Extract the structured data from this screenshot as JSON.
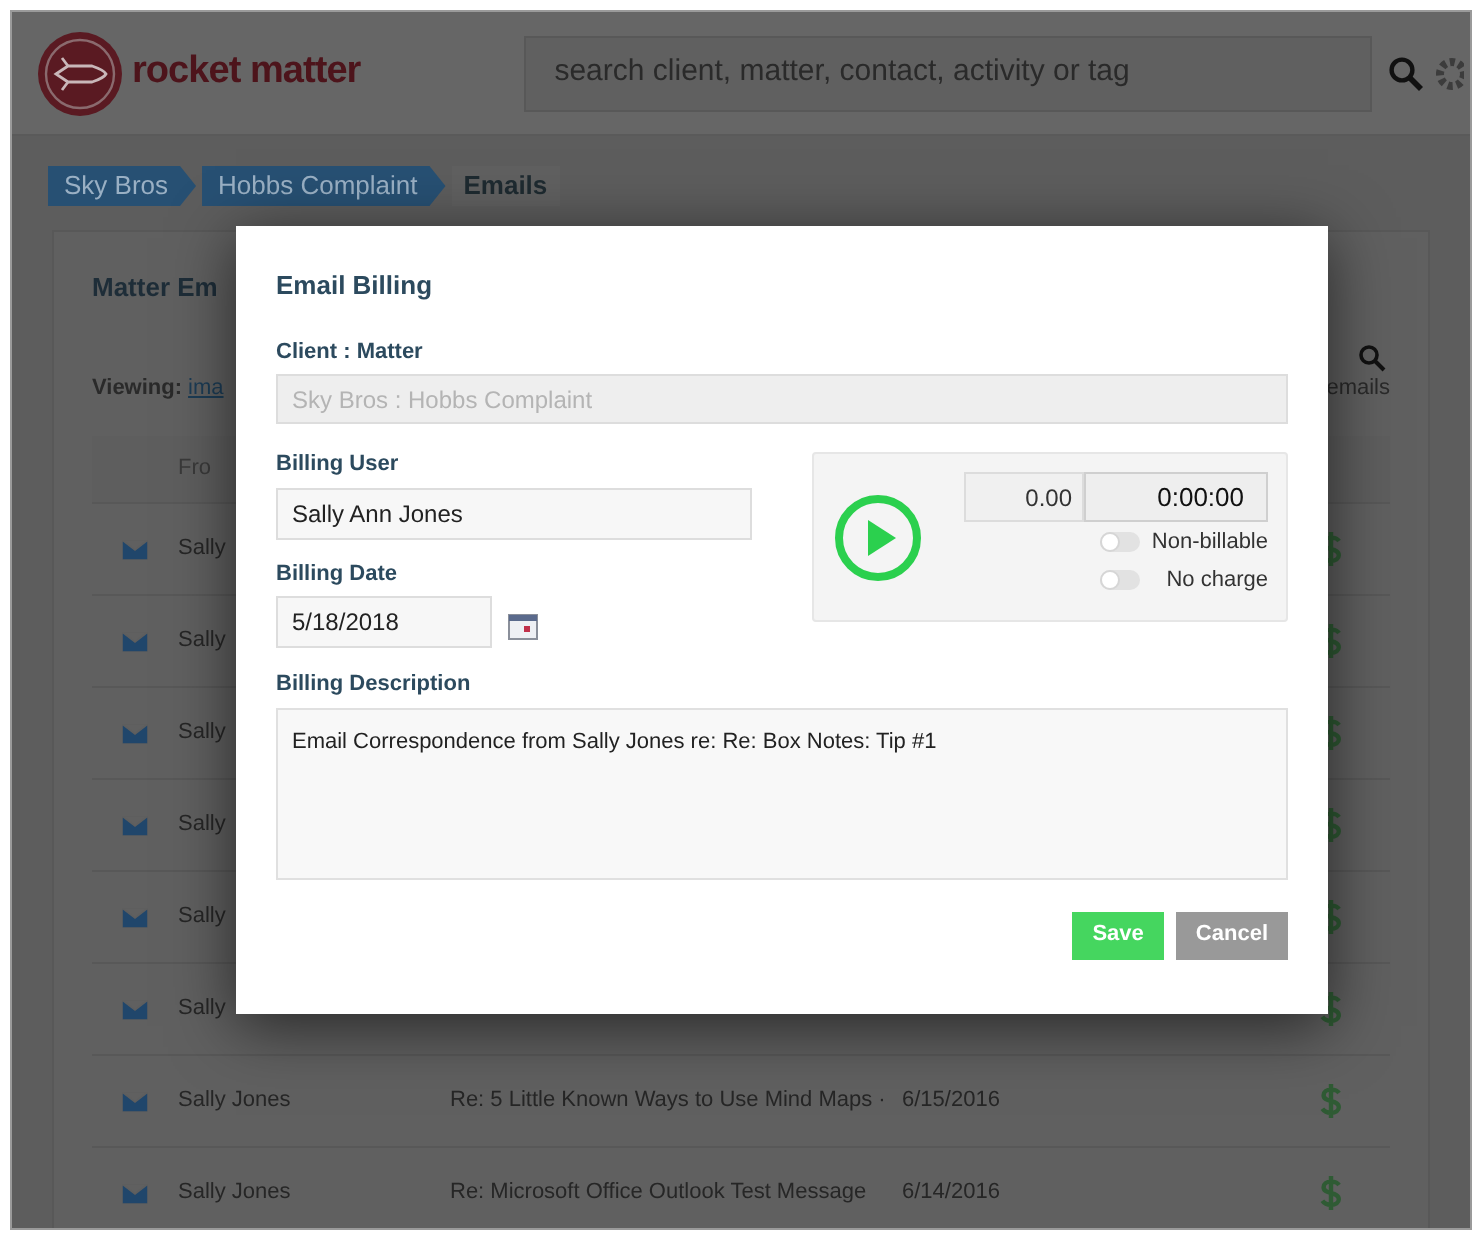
{
  "header": {
    "logo_text": "rocket matter",
    "search": {
      "placeholder": "search client, matter, contact, activity or tag"
    }
  },
  "breadcrumbs": [
    {
      "label": "Sky Bros",
      "selected": false
    },
    {
      "label": "Hobbs Complaint",
      "selected": false
    },
    {
      "label": "Emails",
      "selected": true
    }
  ],
  "panel": {
    "title": "Matter Em",
    "viewing_label": "Viewing:",
    "viewing_link": "ima",
    "search_label": "emails",
    "table": {
      "columns": [
        "Fro"
      ],
      "rows": [
        {
          "from": "Sally"
        },
        {
          "from": "Sally"
        },
        {
          "from": "Sally"
        },
        {
          "from": "Sally"
        },
        {
          "from": "Sally"
        },
        {
          "from": "Sally"
        },
        {
          "from": "Sally Jones",
          "subject": "Re: 5 Little Known Ways to Use Mind Maps ·",
          "date": "6/15/2016"
        },
        {
          "from": "Sally Jones",
          "subject": "Re: Microsoft Office Outlook Test Message",
          "date": "6/14/2016"
        }
      ]
    }
  },
  "dialog": {
    "title": "Email Billing",
    "client_matter": {
      "label": "Client : Matter",
      "value": "Sky Bros : Hobbs Complaint",
      "disabled": true
    },
    "billing_user": {
      "label": "Billing User",
      "value": "Sally Ann Jones"
    },
    "billing_date": {
      "label": "Billing Date",
      "value": "5/18/2018"
    },
    "timer": {
      "amount": "0.00",
      "time": "0:00:00",
      "toggles": [
        {
          "label": "Non-billable",
          "checked": false
        },
        {
          "label": "No charge",
          "checked": false
        }
      ]
    },
    "billing_description": {
      "label": "Billing Description",
      "value": "Email Correspondence from Sally Jones re: Re: Box Notes: Tip #1"
    },
    "buttons": [
      {
        "label": "Save",
        "kind": "primary"
      },
      {
        "label": "Cancel",
        "kind": "secondary"
      }
    ]
  }
}
